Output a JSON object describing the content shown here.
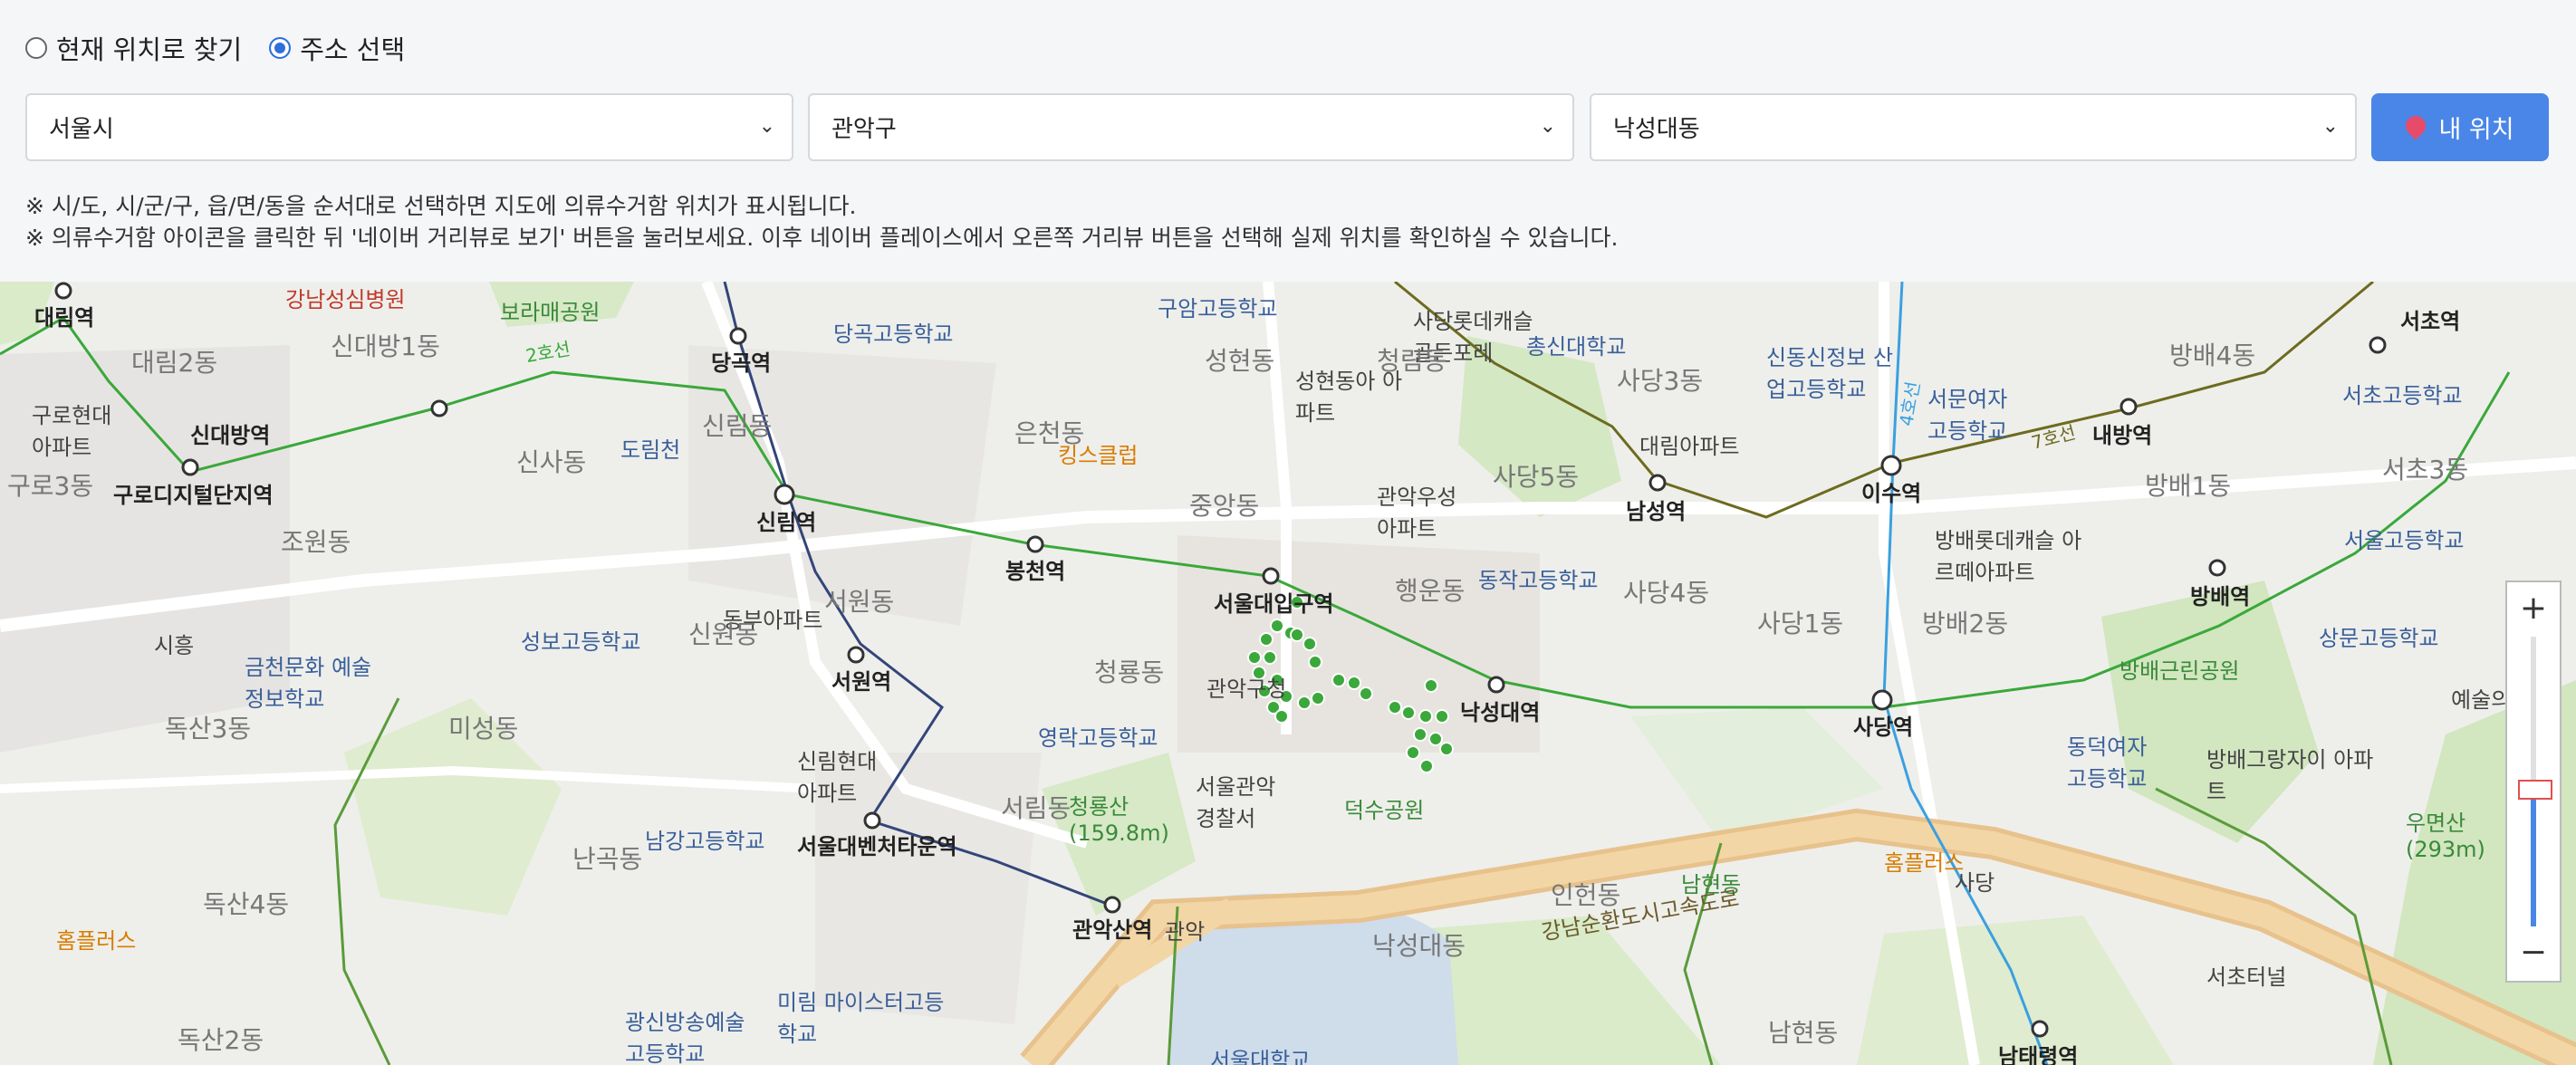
{
  "mode_options": [
    {
      "label": "현재 위치로 찾기",
      "selected": false
    },
    {
      "label": "주소 선택",
      "selected": true
    }
  ],
  "selects": {
    "sido": "서울시",
    "sigungu": "관악구",
    "dong": "낙성대동"
  },
  "locate_button": {
    "label": "내 위치",
    "icon": "map-pin-icon"
  },
  "notes": [
    "※ 시/도, 시/군/구, 읍/면/동을 순서대로 선택하면 지도에 의류수거함 위치가 표시됩니다.",
    "※ 의류수거함 아이콘을 클릭한 뒤 '네이버 거리뷰로 보기' 버튼을 눌러보세요. 이후 네이버 플레이스에서 오른쪽 거리뷰 버튼을 선택해 실제 위치를 확인하실 수 있습니다."
  ],
  "map": {
    "labels": {
      "l1": "대림역",
      "l2": "강남성심병원",
      "l3": "보라매공원",
      "l4": "당곡역",
      "l5": "당곡고등학교",
      "l6": "구암고등학교",
      "l7": "사당롯데캐슬 골든포레",
      "l8": "서초역",
      "l9": "대림2동",
      "l10": "신대방1동",
      "l11": "성현동",
      "l12": "청림동",
      "l13": "성현동아 아파트",
      "l14": "총신대학교",
      "l15": "사당3동",
      "l16": "신동신정보 산업고등학교",
      "l17": "서문여자 고등학교",
      "l18": "방배4동",
      "l19": "서초고등학교",
      "l20": "구로현대 아파트",
      "l21": "신대방역",
      "l22": "신림동",
      "l23": "은천동",
      "l24": "킹스클럽",
      "l25": "대림아파트",
      "l26": "내방역",
      "l27": "구로3동",
      "l28": "구로디지털단지역",
      "l29": "신사동",
      "l30": "도림천",
      "l31": "신림역",
      "l32": "봉천역",
      "l33": "중앙동",
      "l34": "관악우성 아파트",
      "l35": "사당5동",
      "l36": "남성역",
      "l37": "이수역",
      "l38": "방배1동",
      "l39": "서초3동",
      "l40": "조원동",
      "l41": "서원동",
      "l42": "동부아파트",
      "l43": "서울대입구역",
      "l44": "행운동",
      "l45": "동작고등학교",
      "l46": "사당4동",
      "l47": "방배롯데캐슬 아르떼아파트",
      "l48": "서울고등학교",
      "l49": "신원동",
      "l50": "성보고등학교",
      "l51": "시흥",
      "l52": "사당1동",
      "l53": "방배2동",
      "l54": "방배역",
      "l55": "상문고등학교",
      "l56": "금천문화 예술정보학교",
      "l57": "서원역",
      "l58": "청룡동",
      "l59": "관악구청",
      "l60": "낙성대역",
      "l61": "사당역",
      "l62": "방배근린공원",
      "l63": "예술의전당",
      "l64": "독산3동",
      "l65": "미성동",
      "l66": "영락고등학교",
      "l67": "신림현대 아파트",
      "l68": "서울관악 경찰서",
      "l69": "덕수공원",
      "l70": "동덕여자 고등학교",
      "l71": "방배그랑자이 아파트",
      "l72": "서림동",
      "l73": "청룡산 (159.8m)",
      "l74": "우면산 (293m)",
      "l75": "남강고등학교",
      "l76": "서울대벤처타운역",
      "l77": "난곡동",
      "l78": "인헌동",
      "l79": "홈플러스",
      "l80": "사당",
      "l81": "남현동",
      "l82": "독산4동",
      "l83": "홈플러스",
      "l84": "관악산역",
      "l85": "관악",
      "l86": "낙성대동",
      "l87": "강남순환도시고속도로",
      "l88": "광신방송예술 고등학교",
      "l89": "미림 마이스터고등학교",
      "l90": "남현동",
      "l91": "서초터널",
      "l92": "독산2동",
      "l93": "서울대학교",
      "l94": "남태령역",
      "l95": "2호선",
      "l96": "7호선",
      "l97": "4호선"
    },
    "zoom_in": "+",
    "zoom_out": "−"
  }
}
